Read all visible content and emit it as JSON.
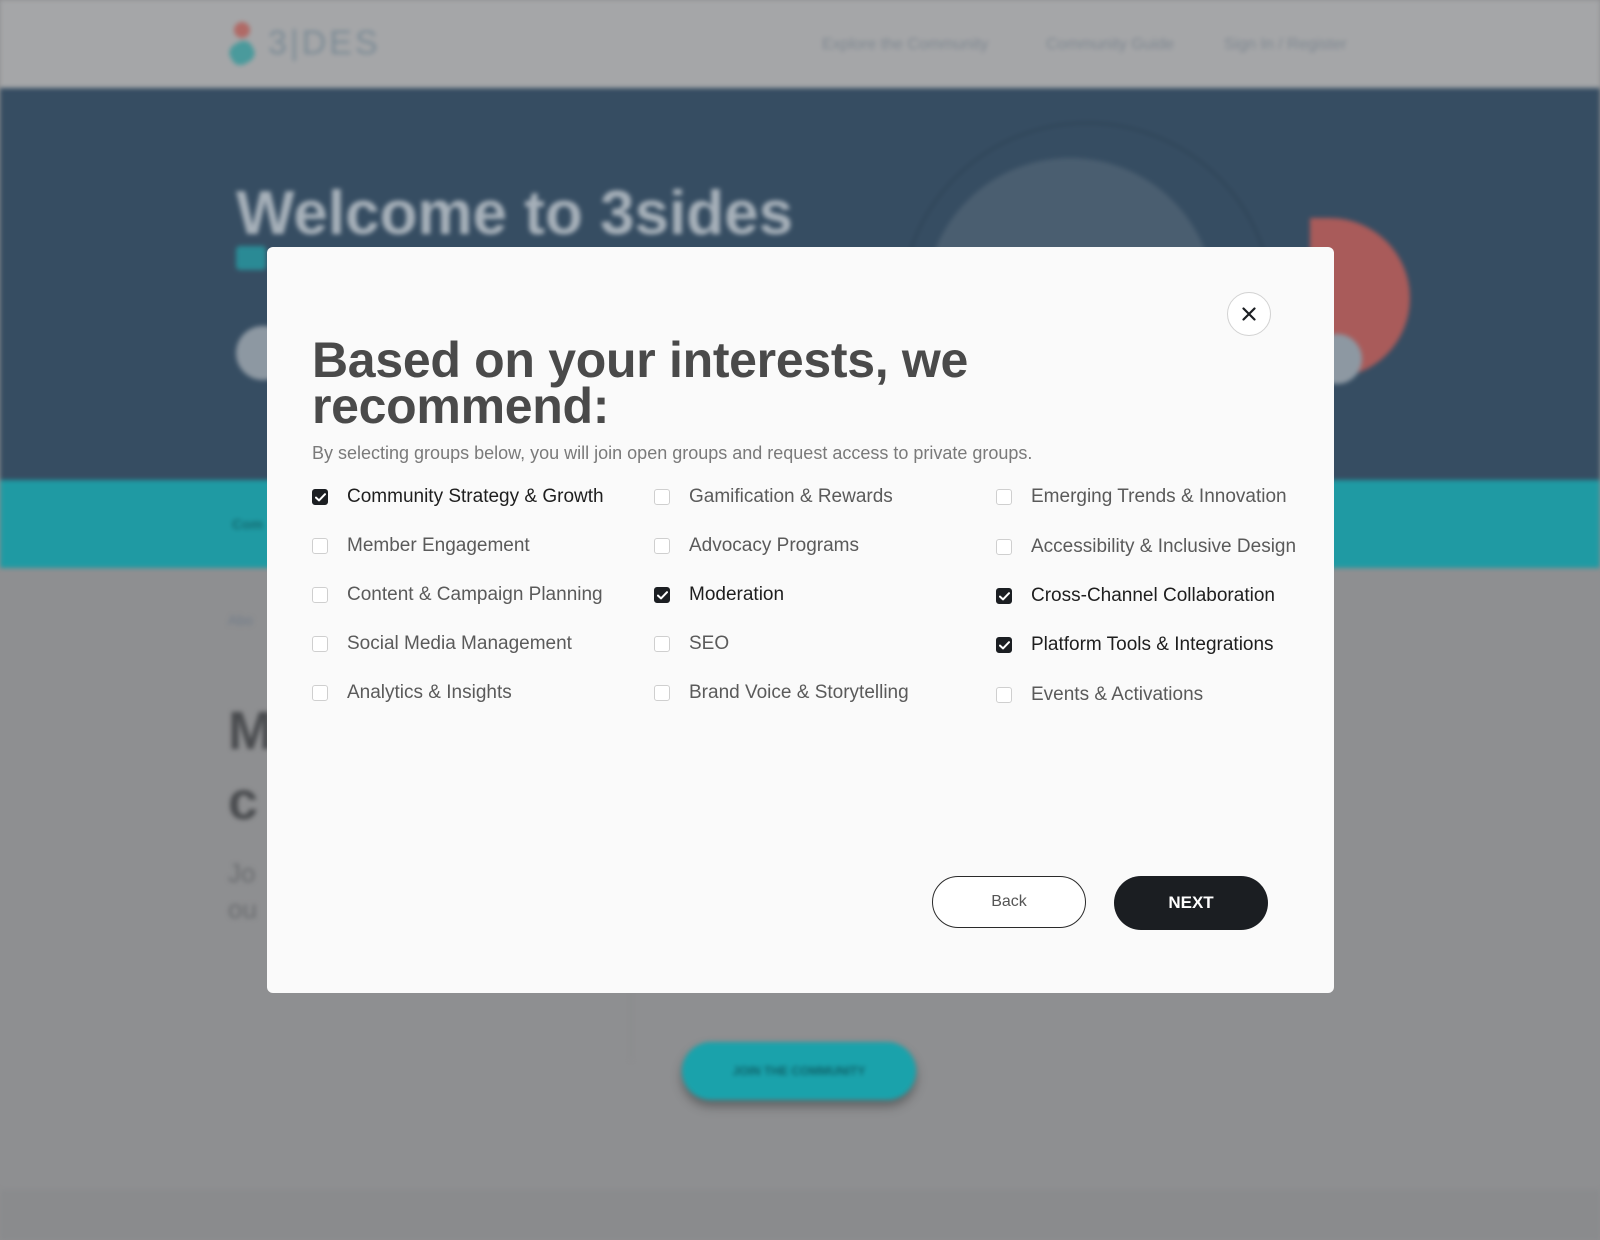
{
  "background": {
    "logo_text": "3|DES",
    "nav": [
      "Explore the Community",
      "Community Guide",
      "Sign In / Register"
    ],
    "hero_title": "Welcome to 3sides",
    "teal_text": "Com",
    "crumb": "Abo",
    "heading_line1": "M",
    "heading_line2": "c",
    "para_line1": "Jo",
    "para_line2": "ou",
    "cta_label": "JOIN THE COMMUNITY"
  },
  "modal": {
    "close_icon": "close-icon",
    "title": "Based on your interests, we recommend:",
    "description": "By selecting groups below, you will join open groups and request access to private groups.",
    "columns": [
      [
        {
          "label": "Community Strategy & Growth",
          "checked": true
        },
        {
          "label": "Member Engagement",
          "checked": false
        },
        {
          "label": "Content & Campaign Planning",
          "checked": false
        },
        {
          "label": "Social Media Management",
          "checked": false
        },
        {
          "label": "Analytics & Insights",
          "checked": false
        }
      ],
      [
        {
          "label": "Gamification & Rewards",
          "checked": false
        },
        {
          "label": "Advocacy Programs",
          "checked": false
        },
        {
          "label": "Moderation",
          "checked": true
        },
        {
          "label": "SEO",
          "checked": false
        },
        {
          "label": "Brand Voice & Storytelling",
          "checked": false
        }
      ],
      [
        {
          "label": "Emerging Trends & Innovation",
          "checked": false
        },
        {
          "label": "Accessibility & Inclusive Design",
          "checked": false
        },
        {
          "label": "Cross-Channel Collaboration",
          "checked": true
        },
        {
          "label": "Platform Tools & Integrations",
          "checked": true
        },
        {
          "label": "Events & Activations",
          "checked": false
        }
      ]
    ],
    "back_label": "Back",
    "next_label": "NEXT"
  },
  "colors": {
    "overlay": "#8e8f91",
    "hero": "#364d62",
    "teal": "#1f9aa3",
    "button_dark": "#1b1e22",
    "modal_bg": "#fafafa"
  }
}
